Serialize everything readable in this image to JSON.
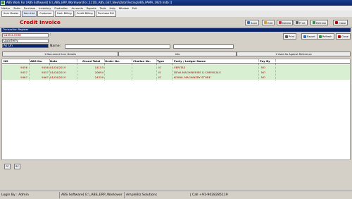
{
  "window": {
    "title": "ABS Work For [ABS Software][ E:\\_ABS_ERP_Work\\workFor_1110\\_ABS_GST_New\\Data\\Testing\\ABS_PAMA_1920.mdb ]]"
  },
  "menu": [
    "Master",
    "Sales",
    "Purchase",
    "Inventory",
    "Production",
    "Accounts",
    "Reports",
    "Tools",
    "Help",
    "Window",
    "Exit"
  ],
  "quick_tabs": [
    "Item Master",
    "Item List",
    "Customer",
    "Cash Billing",
    "Credit Billing",
    "Purchase Bill"
  ],
  "form": {
    "title": "Credit Invoice"
  },
  "toolbar": {
    "save": "Save",
    "edit": "Edit",
    "delete": "Delete",
    "print": "Print",
    "refresh": "Refresh",
    "close": "Close"
  },
  "register": {
    "title": "Transaction Register",
    "type_value": "SalesCredit",
    "period_value": "Quarterly",
    "as_on_value": "As On",
    "colon": ":",
    "name_label": "Name:",
    "name_value": ""
  },
  "register_buttons": {
    "print": "Print",
    "export": "Export",
    "refresh": "Refresh",
    "close": "Close"
  },
  "panels": {
    "document_details": "1 Document Item Details",
    "info": "Info",
    "used_against": "1 Used As Against Reference"
  },
  "table": {
    "columns": {
      "no": "NO",
      "abs_no": "ABS No.",
      "date": "Date",
      "grand_total": "Grand Total",
      "order_no": "Order No.",
      "challan_no": "Challan No.",
      "type": "Type",
      "party": "Party / Ledger Name",
      "pay_by": "Pay By"
    },
    "rows": [
      {
        "no": "9456",
        "abs_no": "9456",
        "date": "01/04/2019",
        "grand_total": "14153",
        "order_no": "",
        "challan_no": "",
        "type": "IS",
        "party": "VERITAS",
        "pay_by": "NO"
      },
      {
        "no": "9457",
        "abs_no": "9457",
        "date": "01/04/2019",
        "grand_total": "20694",
        "order_no": "",
        "challan_no": "",
        "type": "IS",
        "party": "DEVA MACHINERIES & CHEMICALS",
        "pay_by": "NO"
      },
      {
        "no": "9467",
        "abs_no": "9467",
        "date": "01/04/2019",
        "grand_total": "24339",
        "order_no": "",
        "challan_no": "",
        "type": "IS",
        "party": "KOMAL MACHINERY STORE",
        "pay_by": "NO"
      }
    ]
  },
  "bottom_buttons": {
    "pc": "PC",
    "bc": "BC"
  },
  "status": {
    "login": "Login By : Admin",
    "path": "ABS Software[ E:\\_ABS_ERP_Work\\wor",
    "company": "AmpleBiz Solutions",
    "call": "| Call +91-9028285119"
  },
  "icons": [
    "save-icon",
    "edit-icon",
    "delete-icon",
    "print-icon",
    "refresh-icon",
    "close-icon",
    "export-icon",
    "app-icon"
  ],
  "colors": {
    "titlebar": "#0a246a",
    "row_bg": "#d9efd2",
    "row_text": "#a00000",
    "form_title": "#c00000"
  }
}
